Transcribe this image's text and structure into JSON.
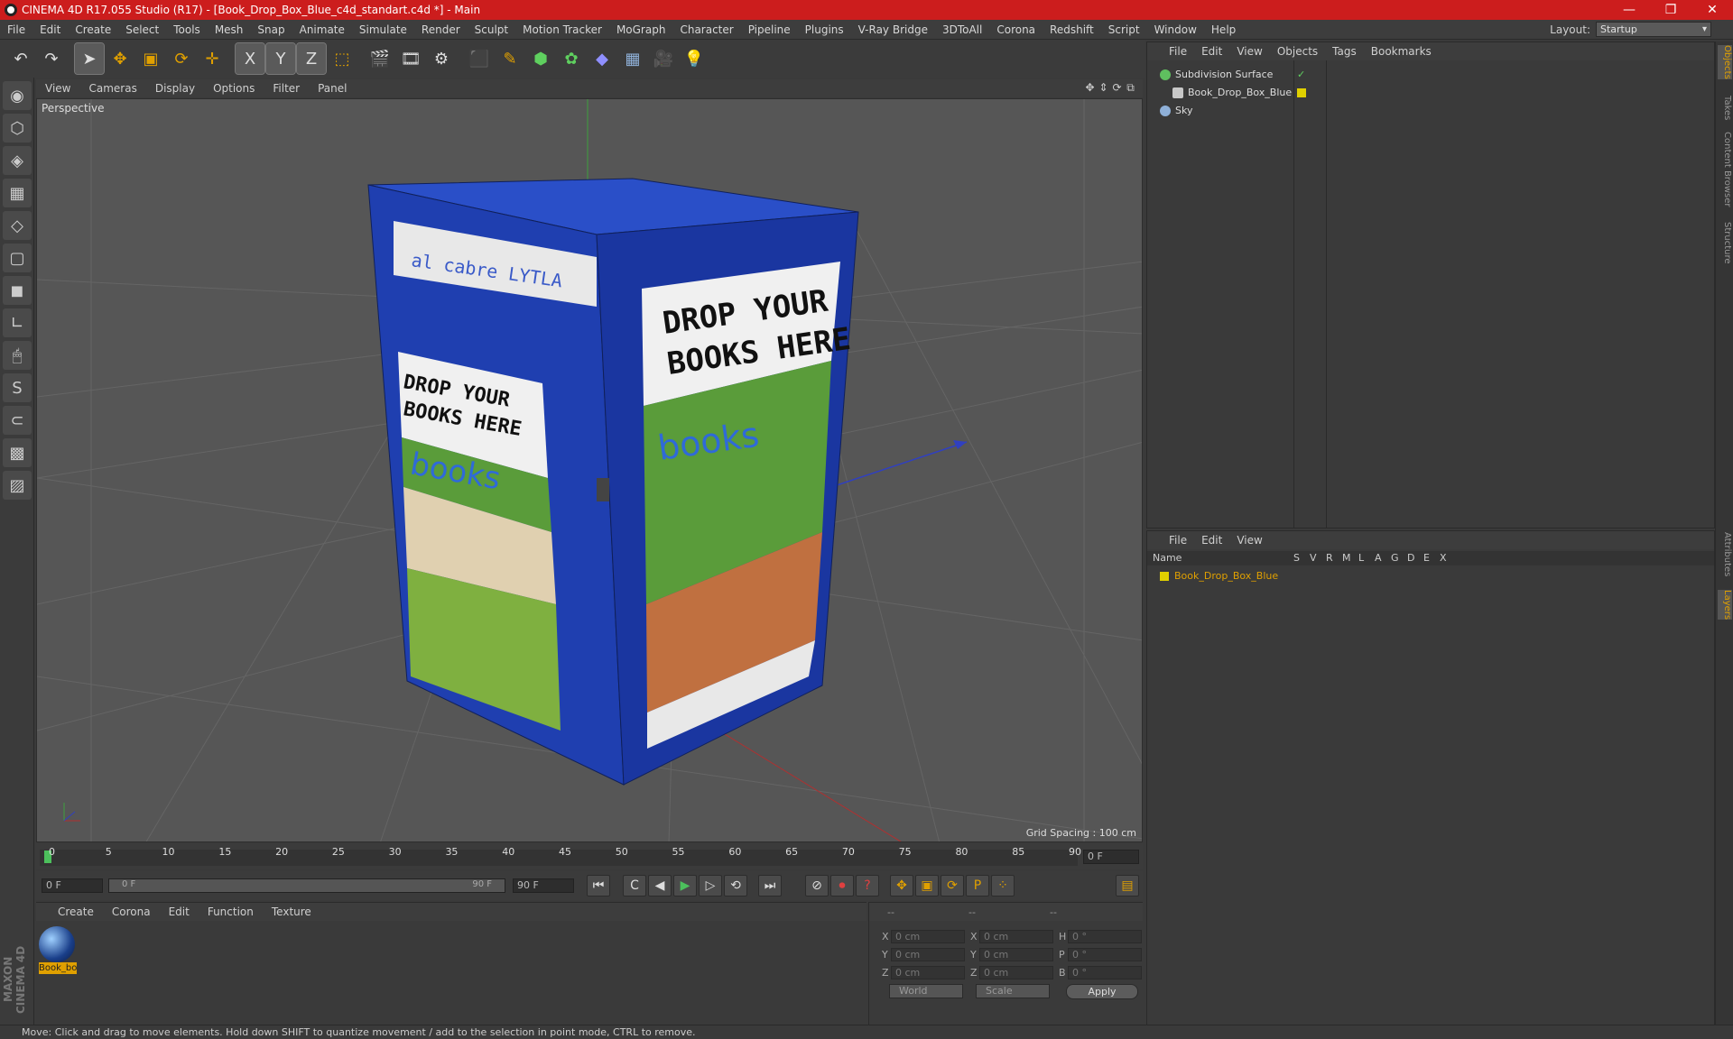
{
  "window": {
    "title": "CINEMA 4D R17.055 Studio (R17) - [Book_Drop_Box_Blue_c4d_standart.c4d *] - Main",
    "minimize": "—",
    "restore": "❐",
    "close": "✕"
  },
  "menu": [
    "File",
    "Edit",
    "Create",
    "Select",
    "Tools",
    "Mesh",
    "Snap",
    "Animate",
    "Simulate",
    "Render",
    "Sculpt",
    "Motion Tracker",
    "MoGraph",
    "Character",
    "Pipeline",
    "Plugins",
    "V-Ray Bridge",
    "3DToAll",
    "Corona",
    "Redshift",
    "Script",
    "Window",
    "Help"
  ],
  "layout": {
    "label": "Layout:",
    "value": "Startup"
  },
  "toolbar": {
    "undo": "↶",
    "redo": "↷",
    "select": "➤",
    "move": "✥",
    "scale": "▣",
    "rotate": "⟳",
    "place": "✛",
    "axis_x": "X",
    "axis_y": "Y",
    "axis_z": "Z",
    "coord": "⬚",
    "render_view": "🎬",
    "render_pic": "🎞",
    "render_settings": "⚙",
    "cube": "⬛",
    "pen": "✎",
    "nurbs": "⬢",
    "array": "✿",
    "deformer": "◆",
    "floor": "▦",
    "camera": "🎥",
    "light": "💡"
  },
  "lefttools": [
    "◉",
    "⬡",
    "◈",
    "▦",
    "◇",
    "▢",
    "◼",
    "∟",
    "🖱",
    "S",
    "⊂",
    "▩",
    "▨"
  ],
  "brand": "MAXON CINEMA 4D",
  "viewport": {
    "menu": [
      "View",
      "Cameras",
      "Display",
      "Options",
      "Filter",
      "Panel"
    ],
    "nav": [
      "✥",
      "⇕",
      "⟳",
      "⧉"
    ],
    "camera": "Perspective",
    "grid_spacing": "Grid Spacing : 100 cm",
    "box_front": [
      "DROP YOUR",
      "BOOKS HERE"
    ],
    "box_side": [
      "DROP YOUR",
      "BOOKS HERE"
    ],
    "box_brand": "books"
  },
  "timeline": {
    "ticks": [
      "0",
      "5",
      "10",
      "15",
      "20",
      "25",
      "30",
      "35",
      "40",
      "45",
      "50",
      "55",
      "60",
      "65",
      "70",
      "75",
      "80",
      "85",
      "90"
    ],
    "frame_field": "0 F",
    "start": "0 F",
    "slider_start": "0 F",
    "slider_end": "90 F",
    "end": "90 F",
    "transport": [
      "⏮",
      "C",
      "◀",
      "▶",
      "▷",
      "⟲",
      "⏭"
    ],
    "keys": [
      "⊘",
      "⏺",
      "?",
      "✥",
      "▣",
      "⟳",
      "P",
      "⁘",
      "▤"
    ]
  },
  "materials": {
    "menu": [
      "Create",
      "Corona",
      "Edit",
      "Function",
      "Texture"
    ],
    "items": [
      {
        "name": "Book_bo"
      }
    ]
  },
  "coordinates": {
    "headers": [
      "--",
      "--",
      "--"
    ],
    "rows": [
      {
        "l1": "X",
        "v1": "0 cm",
        "l2": "X",
        "v2": "0 cm",
        "l3": "H",
        "v3": "0 °"
      },
      {
        "l1": "Y",
        "v1": "0 cm",
        "l2": "Y",
        "v2": "0 cm",
        "l3": "P",
        "v3": "0 °"
      },
      {
        "l1": "Z",
        "v1": "0 cm",
        "l2": "Z",
        "v2": "0 cm",
        "l3": "B",
        "v3": "0 °"
      }
    ],
    "mode": "World",
    "size": "Scale",
    "apply": "Apply"
  },
  "objects": {
    "menu": [
      "File",
      "Edit",
      "View",
      "Objects",
      "Tags",
      "Bookmarks"
    ],
    "items": [
      {
        "name": "Subdivision Surface",
        "color": "#5fbf5f"
      },
      {
        "name": "Book_Drop_Box_Blue",
        "color": "#c8c8c8"
      },
      {
        "name": "Sky",
        "color": "#8fb0d8"
      }
    ],
    "check": "✓"
  },
  "layers": {
    "menu": [
      "File",
      "Edit",
      "View"
    ],
    "columns": [
      "Name",
      "S",
      "V",
      "R",
      "M",
      "L",
      "A",
      "G",
      "D",
      "E",
      "X"
    ],
    "items": [
      {
        "name": "Book_Drop_Box_Blue"
      }
    ]
  },
  "rightstrip": [
    "Objects",
    "Takes",
    "Content Browser",
    "Structure",
    "Attributes",
    "Layers"
  ],
  "status": "Move: Click and drag to move elements. Hold down SHIFT to quantize movement / add to the selection in point mode, CTRL to remove.",
  "colors": {
    "accent": "#cc1d1d",
    "selected": "#e0a000",
    "box_blue": "#1f3fb0",
    "panel": "#3a3a3a"
  }
}
